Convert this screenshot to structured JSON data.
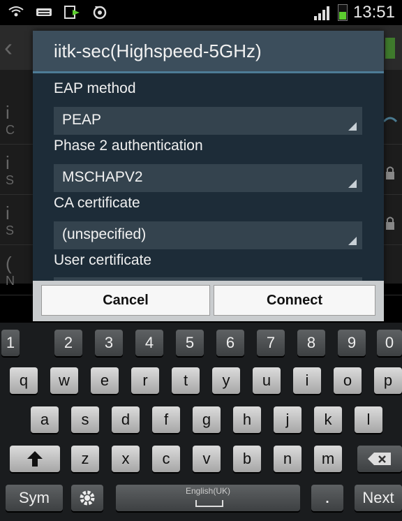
{
  "status_bar": {
    "time": "13:51",
    "icons": [
      "wifi-hotspot-icon",
      "keyboard-icon",
      "download-icon",
      "sync-icon"
    ],
    "battery_color": "#5ccd2f"
  },
  "dialog": {
    "title": "iitk-sec(Highspeed-5GHz)",
    "fields": [
      {
        "label": "EAP method",
        "value": "PEAP"
      },
      {
        "label": "Phase 2 authentication",
        "value": "MSCHAPV2"
      },
      {
        "label": "CA certificate",
        "value": "(unspecified)"
      },
      {
        "label": "User certificate",
        "value": ""
      }
    ],
    "cancel_label": "Cancel",
    "connect_label": "Connect"
  },
  "background_list": {
    "rows": [
      {
        "letter": "i",
        "sub": "C"
      },
      {
        "letter": "i",
        "sub": "S"
      },
      {
        "letter": "i",
        "sub": "S"
      },
      {
        "letter": "(",
        "sub": "N"
      }
    ]
  },
  "keyboard": {
    "number_row": [
      "1",
      "2",
      "3",
      "4",
      "5",
      "6",
      "7",
      "8",
      "9",
      "0"
    ],
    "row1": [
      "q",
      "w",
      "e",
      "r",
      "t",
      "y",
      "u",
      "i",
      "o",
      "p"
    ],
    "row2": [
      "a",
      "s",
      "d",
      "f",
      "g",
      "h",
      "j",
      "k",
      "l"
    ],
    "row3": [
      "z",
      "x",
      "c",
      "v",
      "b",
      "n",
      "m"
    ],
    "sym_label": "Sym",
    "space_label": "English(UK)",
    "next_label": "Next",
    "shift_icon": "shift-arrow-icon",
    "backspace_icon": "backspace-icon",
    "settings_icon": "gear-icon"
  }
}
